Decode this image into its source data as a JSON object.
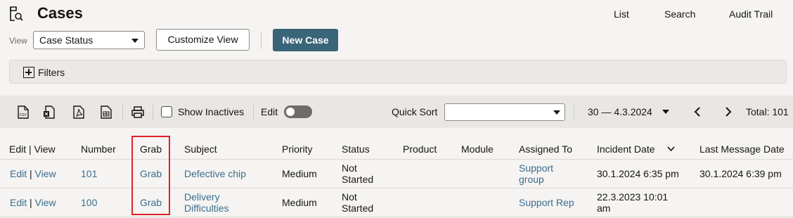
{
  "header": {
    "title": "Cases",
    "nav": [
      "List",
      "Search",
      "Audit Trail"
    ]
  },
  "controls": {
    "view_label": "View",
    "view_value": "Case Status",
    "customize_label": "Customize View",
    "new_case_label": "New Case",
    "filters_label": "Filters"
  },
  "toolbar": {
    "icons": [
      "csv-icon",
      "excel-icon",
      "pdf-icon",
      "spreadsheet-icon",
      "print-icon"
    ],
    "show_inactives": "Show Inactives",
    "edit_label": "Edit",
    "edit_toggle_on": false,
    "quick_sort_label": "Quick Sort",
    "quick_sort_value": "",
    "range_label": "30 — 4.3.2024",
    "total_label": "Total: 101"
  },
  "table": {
    "columns": [
      "Edit | View",
      "Number",
      "Grab",
      "Subject",
      "Priority",
      "Status",
      "Product",
      "Module",
      "Assigned To",
      "Incident Date",
      "Last Message Date"
    ],
    "rows": [
      {
        "edit": "Edit",
        "view": "View",
        "number": "101",
        "grab": "Grab",
        "subject": "Defective chip",
        "priority": "Medium",
        "status_line1": "Not",
        "status_line2": "Started",
        "product": "",
        "module": "",
        "assigned_line1": "Support",
        "assigned_line2": "group",
        "incident_line1": "30.1.2024 6:35 pm",
        "incident_line2": "",
        "last_message": "30.1.2024 6:39 pm"
      },
      {
        "edit": "Edit",
        "view": "View",
        "number": "100",
        "grab": "Grab",
        "subject_line1": "Delivery",
        "subject_line2": "Difficulties",
        "priority": "Medium",
        "status_line1": "Not",
        "status_line2": "Started",
        "product": "",
        "module": "",
        "assigned": "Support Rep",
        "incident_line1": "22.3.2023 10:01",
        "incident_line2": "am",
        "last_message": ""
      }
    ]
  },
  "colors": {
    "primary": "#3a6478",
    "link": "#3a6e8f",
    "highlight": "#e0202a"
  }
}
